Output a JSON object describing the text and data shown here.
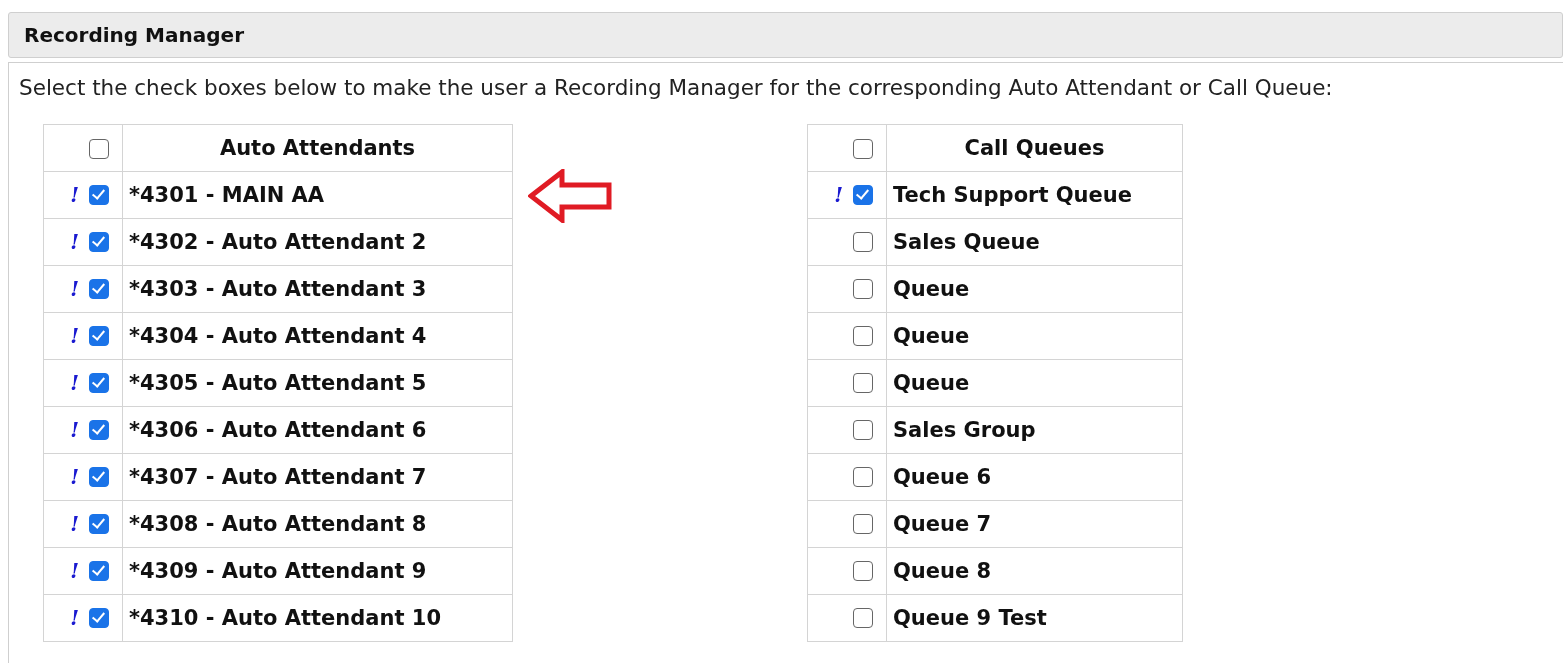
{
  "panel": {
    "title": "Recording Manager",
    "description": "Select the check boxes below to make the user a Recording Manager for the corresponding Auto Attendant or Call Queue:"
  },
  "tables": [
    {
      "heading": "Auto Attendants",
      "all_checked": false,
      "rows": [
        {
          "flag": "!",
          "checked": true,
          "label": "*4301 - MAIN AA",
          "annotation": {
            "kind": "arrow"
          }
        },
        {
          "flag": "!",
          "checked": true,
          "label": "*4302 - Auto Attendant 2"
        },
        {
          "flag": "!",
          "checked": true,
          "label": "*4303 - Auto Attendant 3"
        },
        {
          "flag": "!",
          "checked": true,
          "label": "*4304 - Auto Attendant 4"
        },
        {
          "flag": "!",
          "checked": true,
          "label": "*4305 - Auto Attendant 5"
        },
        {
          "flag": "!",
          "checked": true,
          "label": "*4306 - Auto Attendant 6"
        },
        {
          "flag": "!",
          "checked": true,
          "label": "*4307 - Auto Attendant 7"
        },
        {
          "flag": "!",
          "checked": true,
          "label": "*4308 - Auto Attendant 8"
        },
        {
          "flag": "!",
          "checked": true,
          "label": "*4309 - Auto Attendant 9"
        },
        {
          "flag": "!",
          "checked": true,
          "label": "*4310 - Auto Attendant 10"
        }
      ]
    },
    {
      "heading": "Call Queues",
      "all_checked": false,
      "rows": [
        {
          "flag": "!",
          "checked": true,
          "label": "Tech Support Queue"
        },
        {
          "checked": false,
          "label": "Sales Queue"
        },
        {
          "checked": false,
          "label": "Queue"
        },
        {
          "checked": false,
          "label": "Queue"
        },
        {
          "checked": false,
          "label": "Queue"
        },
        {
          "checked": false,
          "label": "Sales Group"
        },
        {
          "checked": false,
          "label": "Queue 6"
        },
        {
          "checked": false,
          "label": "Queue 7"
        },
        {
          "checked": false,
          "label": "Queue 8"
        },
        {
          "checked": false,
          "label": "Queue 9 Test"
        }
      ]
    }
  ]
}
